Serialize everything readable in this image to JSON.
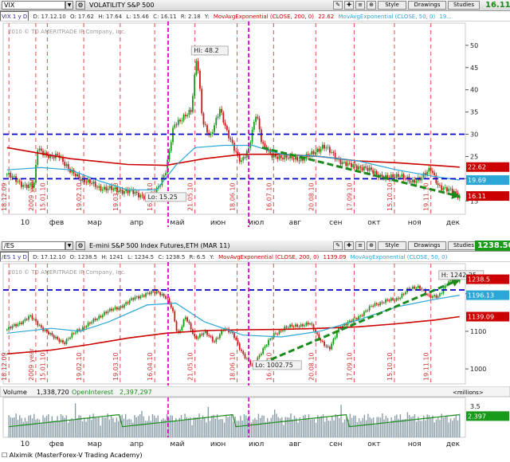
{
  "window": {
    "footer_checkbox": "☐",
    "footer": "Alximik (MasterForex-V Trading Academy)"
  },
  "toolbar": {
    "style_label": "Style",
    "drawings_label": "Drawings",
    "studies_label": "Studies"
  },
  "panel1": {
    "symbol": "VIX",
    "title": "VOLATILITY S&P 500",
    "price": "16.11",
    "studies": {
      "timeframe": "VIX 1 y D",
      "date": "D: 17.12.10",
      "open": "O: 17.62",
      "high": "H: 17.64",
      "low": "L: 15.46",
      "close": "C: 16.11",
      "range": "R: 2.18",
      "y": "Y:",
      "ma200": "MovAvgExponential (CLOSE, 200, 0)",
      "ma200_value": "22.62",
      "ma50": "MovAvgExponential (CLOSE, 50, 0)",
      "ma50_value": "19..."
    }
  },
  "panel2": {
    "symbol": "/ES",
    "title": "E-mini S&P 500 Index Futures,ETH (MAR 11)",
    "price": "1238.50",
    "studies": {
      "timeframe": "/ES 1 y D",
      "date": "D: 17.12.10",
      "open": "O: 1238.5",
      "high": "H: 1241",
      "low": "L: 1234.5",
      "close": "C: 1238.5",
      "range": "R: 6.5",
      "y": "Y:",
      "ma200": "MovAvgExponential (CLOSE, 200, 0)",
      "ma200_value": "1139.09",
      "ma50": "MovAvgExponential (CLOSE, 50, 0)",
      "ma50_value": ""
    }
  },
  "colors": {
    "up": "#1a9a1a",
    "down": "#cc1a1a",
    "ma200": "#cc0000",
    "ma50": "#2aa7d6",
    "level": "#0000cc",
    "event": "#e000c8",
    "month_line": "#e05050",
    "trend": "#1a8a1a",
    "volume": "#8a9ea8"
  },
  "chart_data": [
    {
      "type": "line",
      "id": "vix",
      "copyright": "2010 © TD AMERITRADE IP Company, Inc.",
      "months": [
        {
          "t": 0.4,
          "label": "10"
        },
        {
          "t": 1.9,
          "label": "фев"
        },
        {
          "t": 3.9,
          "label": "мар"
        },
        {
          "t": 6.1,
          "label": "апр"
        },
        {
          "t": 8.2,
          "label": "май"
        },
        {
          "t": 10.3,
          "label": "июн"
        },
        {
          "t": 12.3,
          "label": "июл"
        },
        {
          "t": 14.4,
          "label": "авг"
        },
        {
          "t": 16.5,
          "label": "сен"
        },
        {
          "t": 18.5,
          "label": "окт"
        },
        {
          "t": 20.6,
          "label": "ноя"
        },
        {
          "t": 22.6,
          "label": "дек"
        }
      ],
      "date_labels": [
        {
          "t": -0.2,
          "label": "18.12.09"
        },
        {
          "t": 1.2,
          "label": "2009 year"
        },
        {
          "t": 1.8,
          "label": "15.01.10"
        },
        {
          "t": 3.7,
          "label": "19.02.10"
        },
        {
          "t": 5.6,
          "label": "19.03.10"
        },
        {
          "t": 7.4,
          "label": "16.04.10"
        },
        {
          "t": 9.5,
          "label": "21.05.10"
        },
        {
          "t": 11.7,
          "label": "18.06.10"
        },
        {
          "t": 13.6,
          "label": "16.07.10"
        },
        {
          "t": 15.8,
          "label": "20.08.10"
        },
        {
          "t": 17.8,
          "label": "17.09.10"
        },
        {
          "t": 19.9,
          "label": "15.10.10"
        },
        {
          "t": 21.8,
          "label": "19.11.10"
        }
      ],
      "close": [
        [
          -0.3,
          21.0
        ],
        [
          0.6,
          18.5
        ],
        [
          1.1,
          18.2
        ],
        [
          1.3,
          27.0
        ],
        [
          2.0,
          24.5
        ],
        [
          2.4,
          25.5
        ],
        [
          3.0,
          21.5
        ],
        [
          3.8,
          19.5
        ],
        [
          4.5,
          18.0
        ],
        [
          5.4,
          17.5
        ],
        [
          6.2,
          17.0
        ],
        [
          6.9,
          16.0
        ],
        [
          7.3,
          16.0
        ],
        [
          7.5,
          17.5
        ],
        [
          8.0,
          22.0
        ],
        [
          8.4,
          32.0
        ],
        [
          8.9,
          34.0
        ],
        [
          9.3,
          35.0
        ],
        [
          9.6,
          48.0
        ],
        [
          9.9,
          33.0
        ],
        [
          10.3,
          29.0
        ],
        [
          10.8,
          36.0
        ],
        [
          11.2,
          30.0
        ],
        [
          11.5,
          27.0
        ],
        [
          11.9,
          24.0
        ],
        [
          12.3,
          26.5
        ],
        [
          12.7,
          35.0
        ],
        [
          13.0,
          28.0
        ],
        [
          13.5,
          25.0
        ],
        [
          14.0,
          25.0
        ],
        [
          14.6,
          24.5
        ],
        [
          15.1,
          24.5
        ],
        [
          15.6,
          25.5
        ],
        [
          16.2,
          27.5
        ],
        [
          16.9,
          24.5
        ],
        [
          17.5,
          23.0
        ],
        [
          18.3,
          22.5
        ],
        [
          19.0,
          21.0
        ],
        [
          19.6,
          20.0
        ],
        [
          20.2,
          21.0
        ],
        [
          20.8,
          19.0
        ],
        [
          21.3,
          20.5
        ],
        [
          21.8,
          22.0
        ],
        [
          22.2,
          18.5
        ],
        [
          22.6,
          17.5
        ],
        [
          23.0,
          17.0
        ],
        [
          23.3,
          16.1
        ]
      ],
      "ma200": [
        [
          -0.3,
          27.0
        ],
        [
          3.0,
          24.5
        ],
        [
          6.0,
          23.2
        ],
        [
          8.0,
          23.0
        ],
        [
          10.0,
          24.5
        ],
        [
          12.0,
          25.5
        ],
        [
          14.0,
          25.5
        ],
        [
          16.0,
          25.0
        ],
        [
          18.0,
          24.0
        ],
        [
          20.0,
          23.6
        ],
        [
          22.0,
          23.0
        ],
        [
          23.3,
          22.6
        ]
      ],
      "ma50": [
        [
          -0.3,
          22.0
        ],
        [
          1.5,
          22.5
        ],
        [
          3.0,
          22.0
        ],
        [
          4.5,
          19.5
        ],
        [
          6.0,
          17.5
        ],
        [
          7.5,
          17.5
        ],
        [
          8.5,
          23.0
        ],
        [
          9.5,
          27.0
        ],
        [
          11.0,
          27.5
        ],
        [
          12.5,
          27.5
        ],
        [
          14.0,
          25.5
        ],
        [
          16.0,
          25.0
        ],
        [
          18.0,
          24.0
        ],
        [
          20.0,
          22.0
        ],
        [
          22.0,
          20.5
        ],
        [
          23.3,
          19.7
        ]
      ],
      "hlines": [
        30,
        20
      ],
      "vlines_event": [
        8.1,
        12.3
      ],
      "trend": [
        [
          13.0,
          27.0
        ],
        [
          23.3,
          16.0
        ]
      ],
      "annotations": [
        {
          "t": 9.4,
          "y": 48.2,
          "label": "Hi: 48.2"
        },
        {
          "t": 7.0,
          "y": 15.25,
          "label": "Lo: 15.25"
        }
      ],
      "tags": [
        {
          "y": 22.62,
          "label": "22.62",
          "color": "#cc0000"
        },
        {
          "y": 19.69,
          "label": "19.69",
          "color": "#2aa7d6"
        },
        {
          "y": 16.11,
          "label": "16.11",
          "color": "#cc0000"
        }
      ],
      "y_ticks": [
        15,
        20,
        25,
        30,
        35,
        40,
        45,
        50
      ],
      "ylim": [
        12,
        55
      ],
      "xlim": [
        -0.5,
        23.6
      ]
    },
    {
      "type": "line",
      "id": "es",
      "copyright": "2010 © TD AMERITRADE IP Company, Inc.",
      "date_labels": [
        {
          "t": -0.2,
          "label": "18.12.09"
        },
        {
          "t": 1.2,
          "label": "2009 year"
        },
        {
          "t": 1.8,
          "label": "15.01.10"
        },
        {
          "t": 3.7,
          "label": "19.02.10"
        },
        {
          "t": 5.6,
          "label": "19.03.10"
        },
        {
          "t": 7.4,
          "label": "16.04.10"
        },
        {
          "t": 9.5,
          "label": "21.05.10"
        },
        {
          "t": 11.7,
          "label": "18.06.10"
        },
        {
          "t": 13.6,
          "label": "16.07.10"
        },
        {
          "t": 15.8,
          "label": "20.08.10"
        },
        {
          "t": 17.8,
          "label": "17.09.10"
        },
        {
          "t": 19.9,
          "label": "15.10.10"
        },
        {
          "t": 21.8,
          "label": "19.11.10"
        }
      ],
      "close": [
        [
          -0.3,
          1105
        ],
        [
          0.3,
          1120
        ],
        [
          0.9,
          1140
        ],
        [
          1.5,
          1110
        ],
        [
          2.1,
          1085
        ],
        [
          2.7,
          1070
        ],
        [
          3.3,
          1100
        ],
        [
          4.0,
          1120
        ],
        [
          4.8,
          1150
        ],
        [
          5.6,
          1165
        ],
        [
          6.4,
          1190
        ],
        [
          7.0,
          1200
        ],
        [
          7.6,
          1205
        ],
        [
          8.0,
          1190
        ],
        [
          8.3,
          1160
        ],
        [
          8.6,
          1090
        ],
        [
          9.0,
          1140
        ],
        [
          9.5,
          1080
        ],
        [
          10.0,
          1100
        ],
        [
          10.5,
          1070
        ],
        [
          11.0,
          1110
        ],
        [
          11.5,
          1090
        ],
        [
          12.0,
          1040
        ],
        [
          12.5,
          1005
        ],
        [
          13.0,
          1050
        ],
        [
          13.6,
          1090
        ],
        [
          14.2,
          1110
        ],
        [
          14.8,
          1115
        ],
        [
          15.5,
          1120
        ],
        [
          16.0,
          1080
        ],
        [
          16.5,
          1050
        ],
        [
          17.0,
          1110
        ],
        [
          17.6,
          1125
        ],
        [
          18.2,
          1145
        ],
        [
          18.8,
          1170
        ],
        [
          19.4,
          1180
        ],
        [
          20.0,
          1185
        ],
        [
          20.6,
          1210
        ],
        [
          21.2,
          1220
        ],
        [
          21.7,
          1190
        ],
        [
          22.2,
          1195
        ],
        [
          22.7,
          1230
        ],
        [
          23.3,
          1238.5
        ]
      ],
      "ma200": [
        [
          -0.3,
          1040
        ],
        [
          2.0,
          1050
        ],
        [
          4.0,
          1065
        ],
        [
          6.0,
          1082
        ],
        [
          8.0,
          1095
        ],
        [
          10.0,
          1102
        ],
        [
          12.0,
          1104
        ],
        [
          14.0,
          1105
        ],
        [
          16.0,
          1108
        ],
        [
          18.0,
          1112
        ],
        [
          20.0,
          1120
        ],
        [
          22.0,
          1130
        ],
        [
          23.3,
          1139.09
        ]
      ],
      "ma50": [
        [
          -0.3,
          1095
        ],
        [
          2.0,
          1108
        ],
        [
          3.5,
          1100
        ],
        [
          5.0,
          1125
        ],
        [
          7.0,
          1170
        ],
        [
          8.5,
          1175
        ],
        [
          10.0,
          1125
        ],
        [
          12.0,
          1090
        ],
        [
          14.0,
          1085
        ],
        [
          16.0,
          1100
        ],
        [
          18.0,
          1130
        ],
        [
          20.0,
          1165
        ],
        [
          22.0,
          1185
        ],
        [
          23.3,
          1196.13
        ]
      ],
      "hlines": [
        1210
      ],
      "vlines_event": [
        8.1,
        12.3
      ],
      "trend": [
        [
          13.0,
          1015
        ],
        [
          23.3,
          1238
        ]
      ],
      "annotations": [
        {
          "t": 22.3,
          "y": 1242.25,
          "label": "H: 1242.25"
        },
        {
          "t": 12.6,
          "y": 1002.75,
          "label": "Lo: 1002.75"
        }
      ],
      "tags": [
        {
          "y": 1238.5,
          "label": "1238.5",
          "color": "#cc0000"
        },
        {
          "y": 1196.13,
          "label": "1196.13",
          "color": "#2aa7d6"
        },
        {
          "y": 1139.09,
          "label": "1139.09",
          "color": "#cc0000"
        }
      ],
      "y_ticks": [
        1000,
        1100,
        1200
      ],
      "ylim": [
        960,
        1280
      ],
      "xlim": [
        -0.5,
        23.6
      ]
    },
    {
      "type": "bar",
      "id": "volume",
      "title": "Volume",
      "volume_value": "1,338,720",
      "oi_label": "OpenInterest",
      "oi_value": "2,397,297",
      "units": "<millions>",
      "y_ticks": [
        3.5
      ],
      "ylim": [
        0,
        4.5
      ],
      "xlim": [
        -0.5,
        23.6
      ],
      "tag": {
        "y": 2.397,
        "label": "2.397"
      },
      "months": [
        {
          "t": 0.4,
          "label": "10"
        },
        {
          "t": 1.9,
          "label": "фев"
        },
        {
          "t": 3.9,
          "label": "мар"
        },
        {
          "t": 6.1,
          "label": "апр"
        },
        {
          "t": 8.2,
          "label": "май"
        },
        {
          "t": 10.3,
          "label": "июн"
        },
        {
          "t": 12.3,
          "label": "июл"
        },
        {
          "t": 14.4,
          "label": "авг"
        },
        {
          "t": 16.5,
          "label": "сен"
        },
        {
          "t": 18.5,
          "label": "окт"
        },
        {
          "t": 20.6,
          "label": "ноя"
        },
        {
          "t": 22.6,
          "label": "дек"
        }
      ]
    }
  ]
}
